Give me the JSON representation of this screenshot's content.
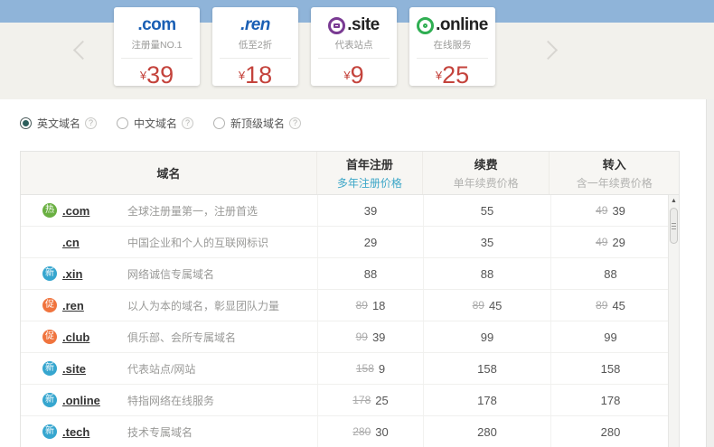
{
  "icons": {
    "prev": "chevron-left",
    "next": "chevron-right",
    "help": "?",
    "scroll_up": "▲",
    "site_badge": "monitor-in-circle",
    "online_badge": "ring-in-circle"
  },
  "colors": {
    "top_band": "#8fb4d9",
    "strip": "#f2f1ec",
    "price_red": "#c4433c",
    "link_blue": "#3ea7c8",
    "badge_hot_green": "#6ab042",
    "badge_new_blue": "#36a6cf",
    "badge_promo_orange": "#f0743e"
  },
  "carousel": {
    "cards": [
      {
        "tld": ".com",
        "tagline": "注册量NO.1",
        "currency": "¥",
        "price": "39",
        "tld_color": "#1a5fb4",
        "icon": "",
        "icon_color": ""
      },
      {
        "tld": ".ren",
        "tagline": "低至2折",
        "currency": "¥",
        "price": "18",
        "tld_color": "#1a5fb4",
        "icon": "",
        "icon_color": ""
      },
      {
        "tld": ".site",
        "tagline": "代表站点",
        "currency": "¥",
        "price": "9",
        "tld_color": "#222222",
        "icon": "monitor-in-circle",
        "icon_color": "#7a3b93"
      },
      {
        "tld": ".online",
        "tagline": "在线服务",
        "currency": "¥",
        "price": "25",
        "tld_color": "#222222",
        "icon": "ring-in-circle",
        "icon_color": "#2fae52"
      }
    ]
  },
  "filters": {
    "options": [
      {
        "label": "英文域名",
        "selected": true
      },
      {
        "label": "中文域名",
        "selected": false
      },
      {
        "label": "新顶级域名",
        "selected": false
      }
    ]
  },
  "table": {
    "header": {
      "domain": "域名",
      "register_title": "首年注册",
      "register_sub": "多年注册价格",
      "renew_title": "续费",
      "renew_sub": "单年续费价格",
      "transfer_title": "转入",
      "transfer_sub": "含一年续费价格"
    },
    "rows": [
      {
        "badge": "热",
        "badge_color": "#6ab042",
        "tld": ".com",
        "desc": "全球注册量第一，注册首选",
        "reg_old": "",
        "reg_now": "39",
        "renew_old": "",
        "renew_now": "55",
        "tr_old": "49",
        "tr_now": "39"
      },
      {
        "badge": "",
        "badge_color": "",
        "tld": ".cn",
        "desc": "中国企业和个人的互联网标识",
        "reg_old": "",
        "reg_now": "29",
        "renew_old": "",
        "renew_now": "35",
        "tr_old": "49",
        "tr_now": "29"
      },
      {
        "badge": "新",
        "badge_color": "#36a6cf",
        "tld": ".xin",
        "desc": "网络诚信专属域名",
        "reg_old": "",
        "reg_now": "88",
        "renew_old": "",
        "renew_now": "88",
        "tr_old": "",
        "tr_now": "88"
      },
      {
        "badge": "促",
        "badge_color": "#f0743e",
        "tld": ".ren",
        "desc": "以人为本的域名，彰显团队力量",
        "reg_old": "89",
        "reg_now": "18",
        "renew_old": "89",
        "renew_now": "45",
        "tr_old": "89",
        "tr_now": "45"
      },
      {
        "badge": "促",
        "badge_color": "#f0743e",
        "tld": ".club",
        "desc": "俱乐部、会所专属域名",
        "reg_old": "99",
        "reg_now": "39",
        "renew_old": "",
        "renew_now": "99",
        "tr_old": "",
        "tr_now": "99"
      },
      {
        "badge": "新",
        "badge_color": "#36a6cf",
        "tld": ".site",
        "desc": "代表站点/网站",
        "reg_old": "158",
        "reg_now": "9",
        "renew_old": "",
        "renew_now": "158",
        "tr_old": "",
        "tr_now": "158"
      },
      {
        "badge": "新",
        "badge_color": "#36a6cf",
        "tld": ".online",
        "desc": "特指网络在线服务",
        "reg_old": "178",
        "reg_now": "25",
        "renew_old": "",
        "renew_now": "178",
        "tr_old": "",
        "tr_now": "178"
      },
      {
        "badge": "新",
        "badge_color": "#36a6cf",
        "tld": ".tech",
        "desc": "技术专属域名",
        "reg_old": "280",
        "reg_now": "30",
        "renew_old": "",
        "renew_now": "280",
        "tr_old": "",
        "tr_now": "280"
      }
    ]
  }
}
